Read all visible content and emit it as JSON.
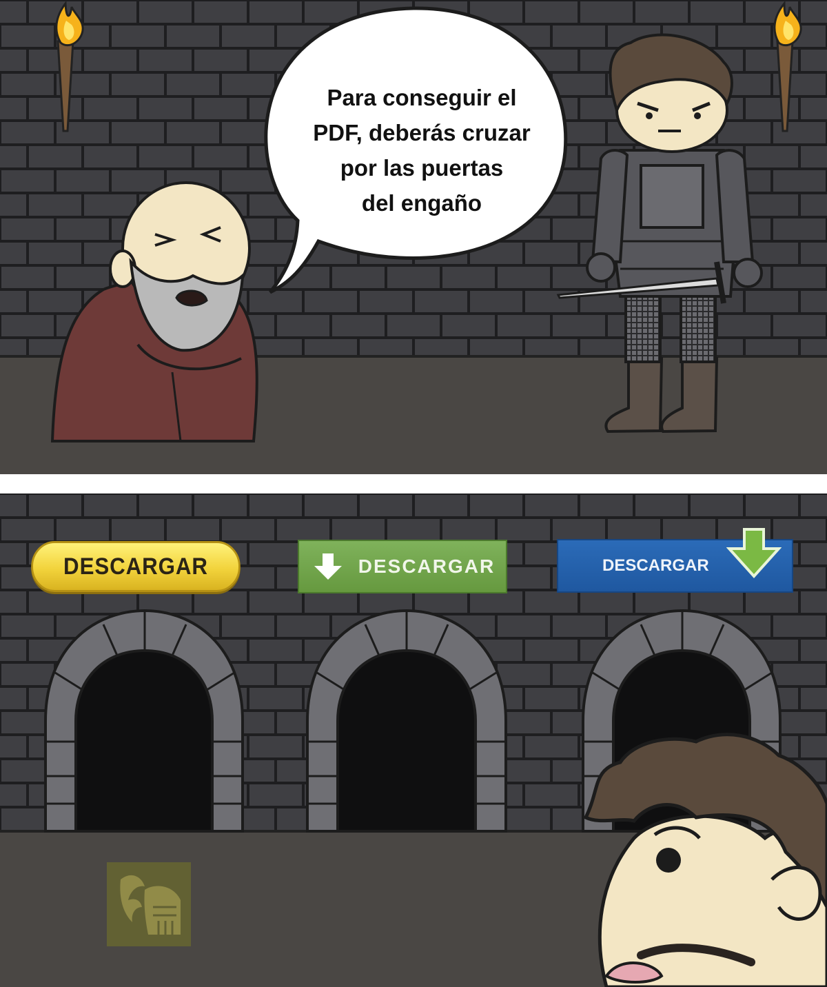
{
  "speech_bubble": {
    "lines": [
      "Para conseguir el",
      "PDF, deberás cruzar",
      "por las puertas",
      "del engaño"
    ]
  },
  "buttons": {
    "yellow_label": "DESCARGAR",
    "green_label": "DESCARGAR",
    "blue_label": "DESCARGAR"
  },
  "colors": {
    "wall": "#3f3f43",
    "floor": "#4a4744",
    "robe": "#6e3a38",
    "skin": "#f3e6c4",
    "beard": "#b9b9b9",
    "armor": "#57575c",
    "hair": "#5a4a3c",
    "yellow_button": "#f2d33c",
    "green_button": "#6f9f49",
    "blue_button": "#2563ad"
  },
  "icons": [
    "torch-icon",
    "arrow-down-icon",
    "watermark-knight-icon"
  ]
}
